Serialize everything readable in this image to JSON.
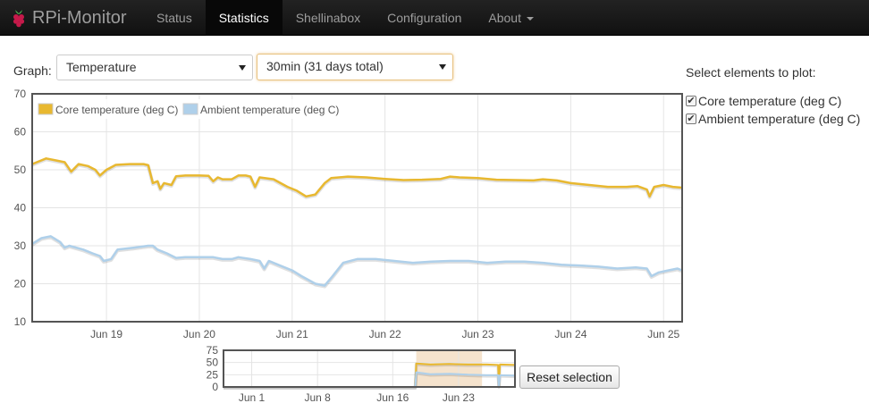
{
  "app": {
    "title": "RPi-Monitor"
  },
  "nav": {
    "items": [
      {
        "label": "Status"
      },
      {
        "label": "Statistics"
      },
      {
        "label": "Shellinabox"
      },
      {
        "label": "Configuration"
      },
      {
        "label": "About"
      }
    ],
    "active_index": 1
  },
  "controls": {
    "graph_label": "Graph:",
    "graph_selected": "Temperature",
    "range_selected": "30min (31 days total)"
  },
  "side_panel": {
    "title": "Select elements to plot:",
    "options": [
      {
        "label": "Core temperature (deg C)",
        "checked": true
      },
      {
        "label": "Ambient temperature (deg C)",
        "checked": true
      }
    ]
  },
  "reset_button": {
    "label": "Reset selection"
  },
  "colors": {
    "core": "#e8b830",
    "ambient": "#afd0ea",
    "selection": "#f3dcc0"
  },
  "chart_data": [
    {
      "type": "line",
      "x_ticks": [
        "Jun 19",
        "Jun 20",
        "Jun 21",
        "Jun 22",
        "Jun 23",
        "Jun 24",
        "Jun 25"
      ],
      "x_tick_pos": [
        1,
        2,
        3,
        4,
        5,
        6,
        7
      ],
      "xlim": [
        0.2,
        7.2
      ],
      "ylim": [
        10,
        70
      ],
      "y_ticks": [
        10,
        20,
        30,
        40,
        50,
        60,
        70
      ],
      "legend": "top-left",
      "grid": true,
      "series": [
        {
          "name": "Core temperature (deg C)",
          "color": "#e8b830",
          "points": [
            [
              0.2,
              51.5
            ],
            [
              0.35,
              53
            ],
            [
              0.45,
              52.5
            ],
            [
              0.55,
              52
            ],
            [
              0.62,
              49.5
            ],
            [
              0.7,
              51.5
            ],
            [
              0.8,
              51
            ],
            [
              0.88,
              50
            ],
            [
              0.93,
              48.5
            ],
            [
              1.0,
              50
            ],
            [
              1.1,
              51.3
            ],
            [
              1.25,
              51.5
            ],
            [
              1.4,
              51.5
            ],
            [
              1.45,
              51.2
            ],
            [
              1.5,
              46.5
            ],
            [
              1.55,
              47
            ],
            [
              1.58,
              45
            ],
            [
              1.62,
              46.5
            ],
            [
              1.7,
              46
            ],
            [
              1.75,
              48.3
            ],
            [
              1.85,
              48.5
            ],
            [
              2.0,
              48.5
            ],
            [
              2.1,
              48.4
            ],
            [
              2.15,
              47
            ],
            [
              2.2,
              48
            ],
            [
              2.25,
              47.5
            ],
            [
              2.35,
              47.5
            ],
            [
              2.42,
              48.5
            ],
            [
              2.5,
              48.5
            ],
            [
              2.55,
              48.2
            ],
            [
              2.6,
              45.5
            ],
            [
              2.65,
              48
            ],
            [
              2.8,
              47.5
            ],
            [
              2.95,
              45.5
            ],
            [
              3.05,
              44.5
            ],
            [
              3.15,
              43
            ],
            [
              3.25,
              43.5
            ],
            [
              3.35,
              46.5
            ],
            [
              3.42,
              47.8
            ],
            [
              3.6,
              48.2
            ],
            [
              3.8,
              48
            ],
            [
              4.0,
              47.6
            ],
            [
              4.2,
              47.3
            ],
            [
              4.4,
              47.4
            ],
            [
              4.6,
              47.6
            ],
            [
              4.7,
              48.2
            ],
            [
              4.8,
              48
            ],
            [
              5.0,
              47.8
            ],
            [
              5.2,
              47.4
            ],
            [
              5.4,
              47.3
            ],
            [
              5.6,
              47.2
            ],
            [
              5.7,
              47.5
            ],
            [
              5.85,
              47.2
            ],
            [
              6.0,
              46.5
            ],
            [
              6.2,
              46
            ],
            [
              6.4,
              45.5
            ],
            [
              6.6,
              45.5
            ],
            [
              6.72,
              45.7
            ],
            [
              6.82,
              44.8
            ],
            [
              6.85,
              43
            ],
            [
              6.9,
              45.5
            ],
            [
              7.0,
              46
            ],
            [
              7.1,
              45.5
            ],
            [
              7.2,
              45.3
            ]
          ]
        },
        {
          "name": "Ambient temperature (deg C)",
          "color": "#afd0ea",
          "points": [
            [
              0.2,
              30.5
            ],
            [
              0.3,
              32
            ],
            [
              0.4,
              32.5
            ],
            [
              0.5,
              31
            ],
            [
              0.55,
              29.5
            ],
            [
              0.6,
              30
            ],
            [
              0.75,
              29
            ],
            [
              0.85,
              28
            ],
            [
              0.93,
              27.3
            ],
            [
              0.97,
              26
            ],
            [
              1.05,
              26.5
            ],
            [
              1.12,
              29
            ],
            [
              1.3,
              29.5
            ],
            [
              1.45,
              30
            ],
            [
              1.5,
              30
            ],
            [
              1.55,
              29
            ],
            [
              1.65,
              28
            ],
            [
              1.75,
              26.8
            ],
            [
              1.85,
              27
            ],
            [
              2.0,
              27
            ],
            [
              2.15,
              27
            ],
            [
              2.25,
              26.5
            ],
            [
              2.35,
              26.5
            ],
            [
              2.42,
              27
            ],
            [
              2.55,
              26.5
            ],
            [
              2.65,
              26
            ],
            [
              2.7,
              24
            ],
            [
              2.75,
              26
            ],
            [
              2.85,
              25
            ],
            [
              3.0,
              23.5
            ],
            [
              3.1,
              22
            ],
            [
              3.25,
              20
            ],
            [
              3.35,
              19.5
            ],
            [
              3.42,
              21.5
            ],
            [
              3.55,
              25.5
            ],
            [
              3.7,
              26.5
            ],
            [
              3.9,
              26.5
            ],
            [
              4.1,
              26
            ],
            [
              4.3,
              25.5
            ],
            [
              4.5,
              25.8
            ],
            [
              4.7,
              26
            ],
            [
              4.9,
              26
            ],
            [
              5.1,
              25.5
            ],
            [
              5.3,
              25.8
            ],
            [
              5.5,
              25.8
            ],
            [
              5.7,
              25.5
            ],
            [
              5.9,
              25
            ],
            [
              6.1,
              24.8
            ],
            [
              6.3,
              24.5
            ],
            [
              6.5,
              24
            ],
            [
              6.7,
              24.3
            ],
            [
              6.82,
              24
            ],
            [
              6.87,
              22
            ],
            [
              6.95,
              23
            ],
            [
              7.05,
              23.5
            ],
            [
              7.15,
              24
            ],
            [
              7.2,
              23.5
            ]
          ]
        }
      ]
    },
    {
      "type": "line",
      "x_ticks": [
        "Jun 1",
        "Jun 8",
        "Jun 16",
        "Jun 23"
      ],
      "x_tick_pos": [
        1,
        8,
        16,
        23
      ],
      "xlim": [
        -2,
        29
      ],
      "ylim": [
        0,
        75
      ],
      "y_ticks": [
        0,
        25,
        50,
        75
      ],
      "selection": [
        18.5,
        25.5
      ],
      "series": [
        {
          "name": "Core temperature (deg C)",
          "color": "#e8b830",
          "points": [
            [
              -2,
              0
            ],
            [
              18.4,
              0
            ],
            [
              18.5,
              48
            ],
            [
              20,
              46
            ],
            [
              22,
              47
            ],
            [
              24,
              46
            ],
            [
              26,
              46
            ],
            [
              27.2,
              45
            ],
            [
              27.3,
              2
            ],
            [
              27.4,
              46
            ],
            [
              29,
              45
            ]
          ]
        },
        {
          "name": "Ambient temperature (deg C)",
          "color": "#afd0ea",
          "points": [
            [
              -2,
              0
            ],
            [
              18.4,
              0
            ],
            [
              18.5,
              30
            ],
            [
              20,
              26
            ],
            [
              22,
              27
            ],
            [
              24,
              25
            ],
            [
              26,
              24
            ],
            [
              27.2,
              24
            ],
            [
              27.3,
              2
            ],
            [
              27.4,
              24
            ],
            [
              29,
              23
            ]
          ]
        }
      ]
    }
  ]
}
